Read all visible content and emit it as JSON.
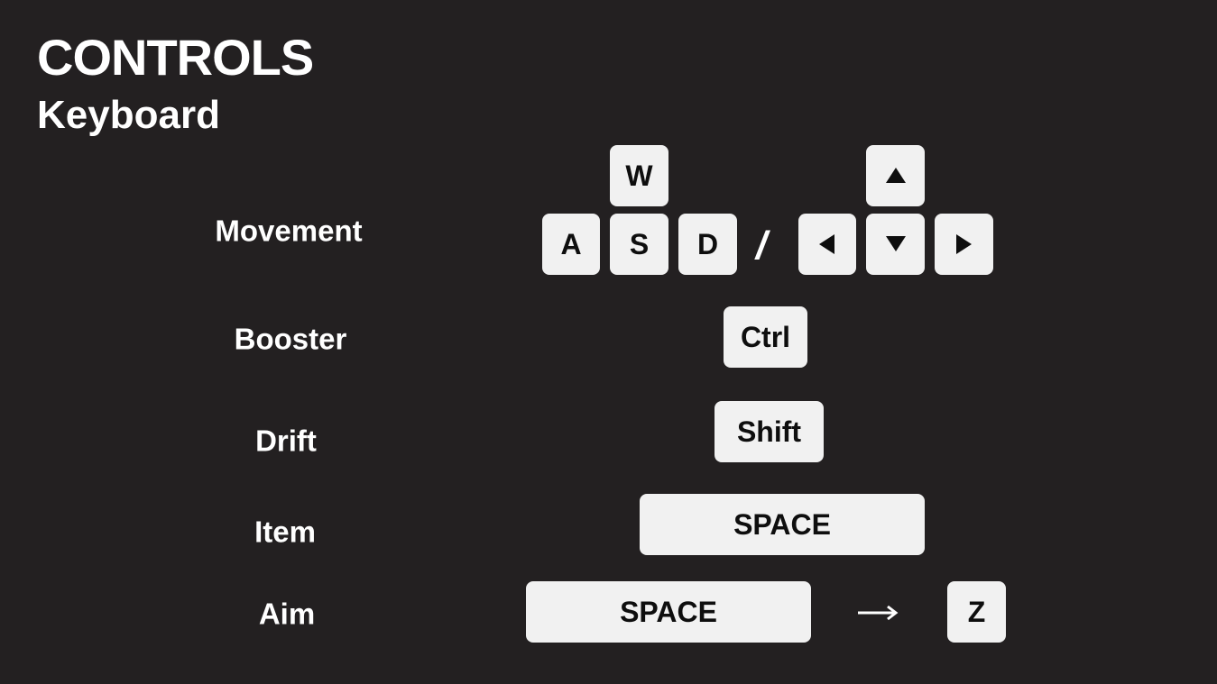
{
  "header": {
    "title": "CONTROLS",
    "subtitle": "Keyboard"
  },
  "rows": {
    "movement": {
      "label": "Movement",
      "keys": {
        "w": "W",
        "a": "A",
        "s": "S",
        "d": "D"
      },
      "separator": "/",
      "arrow_keys": [
        "arrow-up-icon",
        "arrow-left-icon",
        "arrow-down-icon",
        "arrow-right-icon"
      ]
    },
    "booster": {
      "label": "Booster",
      "key": "Ctrl"
    },
    "drift": {
      "label": "Drift",
      "key": "Shift"
    },
    "item": {
      "label": "Item",
      "key": "SPACE"
    },
    "aim": {
      "label": "Aim",
      "key": "SPACE",
      "then_icon": "right-arrow-icon",
      "then_key": "Z"
    }
  },
  "colors": {
    "background": "#232021",
    "key_face": "#f1f1f1",
    "key_text": "#0e0e0e",
    "label_text": "#ffffff"
  }
}
